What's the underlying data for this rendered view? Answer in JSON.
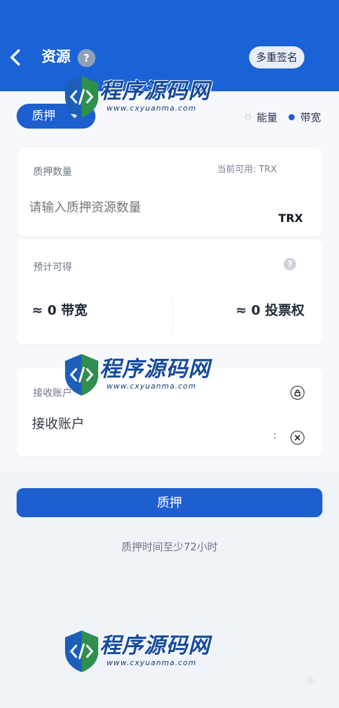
{
  "header": {
    "title": "资源",
    "help_glyph": "?",
    "multisig_label": "多重签名",
    "background_color": "#1a63d6"
  },
  "controls": {
    "stake_mode": "质押",
    "resource_options": [
      "能量",
      "带宽"
    ],
    "selected_resource": "带宽"
  },
  "stake_amount": {
    "label": "质押数量",
    "available": "当前可用: TRX",
    "placeholder": "请输入质押资源数量",
    "unit": "TRX"
  },
  "estimate": {
    "label": "预计可得",
    "help_glyph": "?",
    "bandwidth": "≈ 0 带宽",
    "votes": "≈ 0 投票权"
  },
  "receiver": {
    "label": "接收账户",
    "value": "接收账户",
    "separator": ":"
  },
  "submit_label": "质押",
  "note": "质押时间至少72小时",
  "watermark": {
    "brand": "程序源码网",
    "url": "www.cxyuanma.com"
  },
  "colors": {
    "accent": "#1e5fcf",
    "page_bg": "#f0f3f8"
  }
}
